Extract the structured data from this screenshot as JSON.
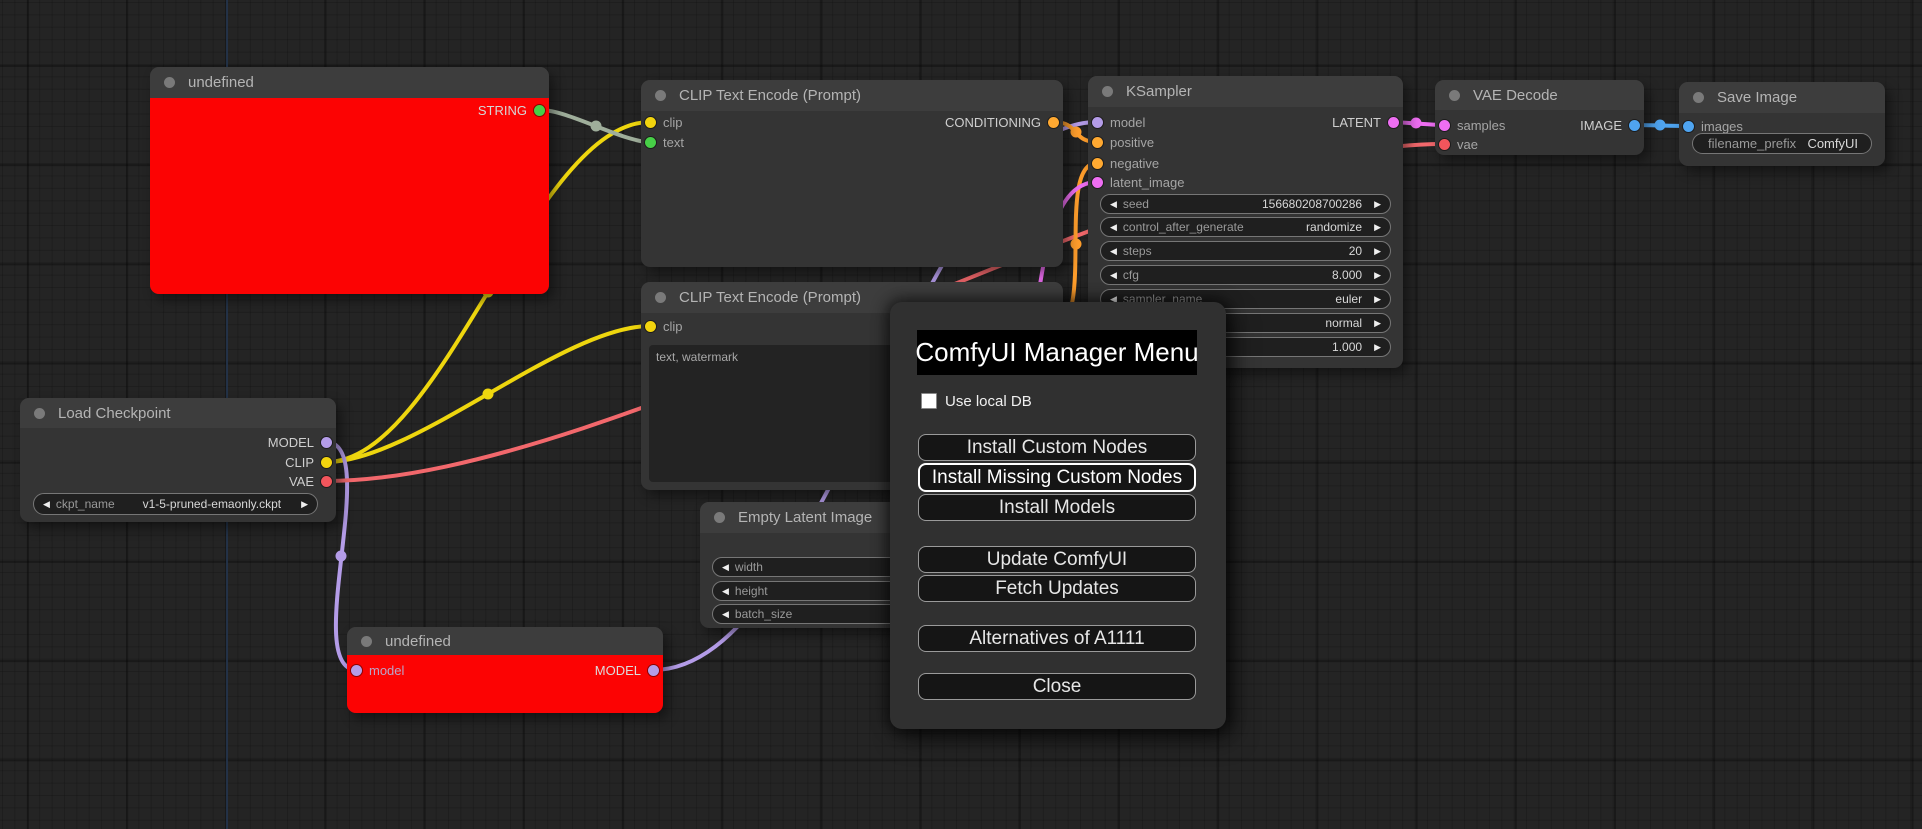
{
  "canvas": {
    "colors": {
      "string_link": "#9fae9b",
      "clip_link": "#eed60e",
      "model_link": "#b49ce8",
      "vae_link": "#f2686c",
      "conditioning_link": "#ff9e2c",
      "latent_link": "#ee6ef2",
      "image_link": "#4fa4f0",
      "error_node_body": "#fc0303",
      "node_body": "#343434",
      "node_title": "#3d3d3d",
      "dialog_bg": "#303030"
    }
  },
  "icons": {
    "arrow_left": "◀",
    "arrow_right": "▶"
  },
  "nodes": {
    "undef_top": {
      "title": "undefined",
      "outputs": [
        {
          "label": "STRING"
        }
      ]
    },
    "clip1": {
      "title": "CLIP Text Encode (Prompt)",
      "inputs": [
        {
          "label": "clip"
        },
        {
          "label": "text"
        }
      ],
      "outputs": [
        {
          "label": "CONDITIONING"
        }
      ]
    },
    "ksampler": {
      "title": "KSampler",
      "inputs": [
        {
          "label": "model"
        },
        {
          "label": "positive"
        },
        {
          "label": "negative"
        },
        {
          "label": "latent_image"
        }
      ],
      "outputs": [
        {
          "label": "LATENT"
        }
      ],
      "widgets": [
        {
          "label": "seed",
          "value": "156680208700286"
        },
        {
          "label": "control_after_generate",
          "value": "randomize"
        },
        {
          "label": "steps",
          "value": "20"
        },
        {
          "label": "cfg",
          "value": "8.000"
        },
        {
          "label": "sampler_name",
          "value": "euler"
        },
        {
          "label": "",
          "value": "normal"
        },
        {
          "label": "",
          "value": "1.000"
        }
      ]
    },
    "vae_decode": {
      "title": "VAE Decode",
      "inputs": [
        {
          "label": "samples"
        },
        {
          "label": "vae"
        }
      ],
      "outputs": [
        {
          "label": "IMAGE"
        }
      ]
    },
    "save_image": {
      "title": "Save Image",
      "inputs": [
        {
          "label": "images"
        }
      ],
      "widget": {
        "label": "filename_prefix",
        "value": "ComfyUI"
      }
    },
    "clip2": {
      "title": "CLIP Text Encode (Prompt)",
      "inputs": [
        {
          "label": "clip"
        }
      ],
      "text_value": "text, watermark"
    },
    "empty_latent": {
      "title": "Empty Latent Image",
      "widgets": [
        {
          "label": "width"
        },
        {
          "label": "height"
        },
        {
          "label": "batch_size"
        }
      ]
    },
    "undef_bottom": {
      "title": "undefined",
      "inputs": [
        {
          "label": "model"
        }
      ],
      "outputs": [
        {
          "label": "MODEL"
        }
      ]
    },
    "checkpoint": {
      "title": "Load Checkpoint",
      "outputs": [
        {
          "label": "MODEL"
        },
        {
          "label": "CLIP"
        },
        {
          "label": "VAE"
        }
      ],
      "widget": {
        "label": "ckpt_name",
        "value": "v1-5-pruned-emaonly.ckpt"
      }
    }
  },
  "dialog": {
    "title": "ComfyUI Manager Menu",
    "checkbox_label": "Use local DB",
    "buttons": [
      {
        "label": "Install Custom Nodes",
        "highlighted": false
      },
      {
        "label": "Install Missing Custom Nodes",
        "highlighted": true
      },
      {
        "label": "Install Models",
        "highlighted": false
      },
      {
        "label": "Update ComfyUI",
        "highlighted": false
      },
      {
        "label": "Fetch Updates",
        "highlighted": false
      },
      {
        "label": "Alternatives of A1111",
        "highlighted": false
      },
      {
        "label": "Close",
        "highlighted": false
      }
    ]
  }
}
